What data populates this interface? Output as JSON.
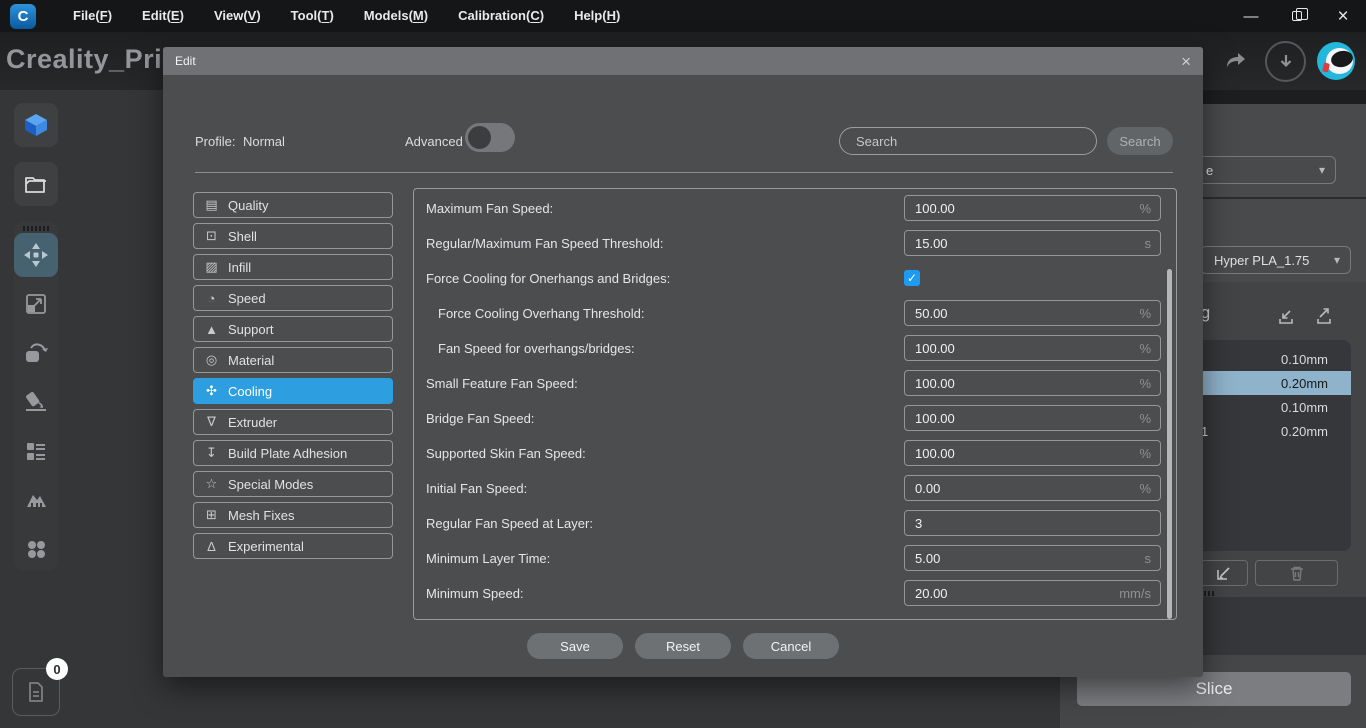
{
  "icons": {
    "check": "✓",
    "chevron_down": "▾",
    "close": "×",
    "minimize": "—"
  },
  "menu": {
    "items": [
      {
        "label": "File",
        "key": "F"
      },
      {
        "label": "Edit",
        "key": "E"
      },
      {
        "label": "View",
        "key": "V"
      },
      {
        "label": "Tool",
        "key": "T"
      },
      {
        "label": "Models",
        "key": "M"
      },
      {
        "label": "Calibration",
        "key": "C"
      },
      {
        "label": "Help",
        "key": "H"
      }
    ]
  },
  "header": {
    "title": "Creality_Print"
  },
  "sidebar": {
    "badge_count": "0"
  },
  "dialog": {
    "title": "Edit",
    "profile_label": "Profile:",
    "profile_value": "Normal",
    "advanced_label": "Advanced",
    "advanced_enabled": false,
    "search_placeholder": "Search",
    "search_button_label": "Search",
    "categories": [
      {
        "label": "Quality",
        "glyph": "▤",
        "selected": false
      },
      {
        "label": "Shell",
        "glyph": "⊡",
        "selected": false
      },
      {
        "label": "Infill",
        "glyph": "▨",
        "selected": false
      },
      {
        "label": "Speed",
        "glyph": "◔",
        "selected": false
      },
      {
        "label": "Support",
        "glyph": "▲",
        "selected": false
      },
      {
        "label": "Material",
        "glyph": "◎",
        "selected": false
      },
      {
        "label": "Cooling",
        "glyph": "✣",
        "selected": true
      },
      {
        "label": "Extruder",
        "glyph": "∇",
        "selected": false
      },
      {
        "label": "Build Plate Adhesion",
        "glyph": "↧",
        "selected": false
      },
      {
        "label": "Special Modes",
        "glyph": "☆",
        "selected": false
      },
      {
        "label": "Mesh Fixes",
        "glyph": "⊞",
        "selected": false
      },
      {
        "label": "Experimental",
        "glyph": "Δ",
        "selected": false
      }
    ],
    "settings": [
      {
        "label": "Maximum Fan Speed:",
        "type": "input",
        "value": "100.00",
        "unit": "%",
        "indent": false
      },
      {
        "label": "Regular/Maximum Fan Speed Threshold:",
        "type": "input",
        "value": "15.00",
        "unit": "s",
        "indent": false
      },
      {
        "label": "Force Cooling for Onerhangs and Bridges:",
        "type": "checkbox",
        "checked": true,
        "indent": false
      },
      {
        "label": "Force Cooling Overhang Threshold:",
        "type": "input",
        "value": "50.00",
        "unit": "%",
        "indent": true
      },
      {
        "label": "Fan Speed for overhangs/bridges:",
        "type": "input",
        "value": "100.00",
        "unit": "%",
        "indent": true
      },
      {
        "label": "Small Feature Fan Speed:",
        "type": "input",
        "value": "100.00",
        "unit": "%",
        "indent": false
      },
      {
        "label": "Bridge Fan Speed:",
        "type": "input",
        "value": "100.00",
        "unit": "%",
        "indent": false
      },
      {
        "label": "Supported Skin Fan Speed:",
        "type": "input",
        "value": "100.00",
        "unit": "%",
        "indent": false
      },
      {
        "label": "Initial Fan Speed:",
        "type": "input",
        "value": "0.00",
        "unit": "%",
        "indent": false
      },
      {
        "label": "Regular Fan Speed at Layer:",
        "type": "input",
        "value": "3",
        "unit": "",
        "indent": false
      },
      {
        "label": "Minimum Layer Time:",
        "type": "input",
        "value": "5.00",
        "unit": "s",
        "indent": false
      },
      {
        "label": "Minimum Speed:",
        "type": "input",
        "value": "20.00",
        "unit": "mm/s",
        "indent": false
      }
    ],
    "footer_buttons": {
      "save": "Save",
      "reset": "Reset",
      "cancel": "Cancel"
    }
  },
  "right_panel": {
    "printer_select_visible_text": "e",
    "filament_select": "Hyper PLA_1.75",
    "config_header_visible_text": "ig",
    "layers": [
      {
        "left": "",
        "height": "0.10mm",
        "selected": false
      },
      {
        "left": "",
        "height": "0.20mm",
        "selected": true
      },
      {
        "left": "",
        "height": "0.10mm",
        "selected": false
      },
      {
        "left": "1",
        "height": "0.20mm",
        "selected": false
      }
    ],
    "slice_label": "Slice"
  },
  "colors": {
    "accent": "#2d9fe0",
    "checkbox_blue": "#1e9bf0",
    "layer_selected": "#8fb3ca"
  }
}
